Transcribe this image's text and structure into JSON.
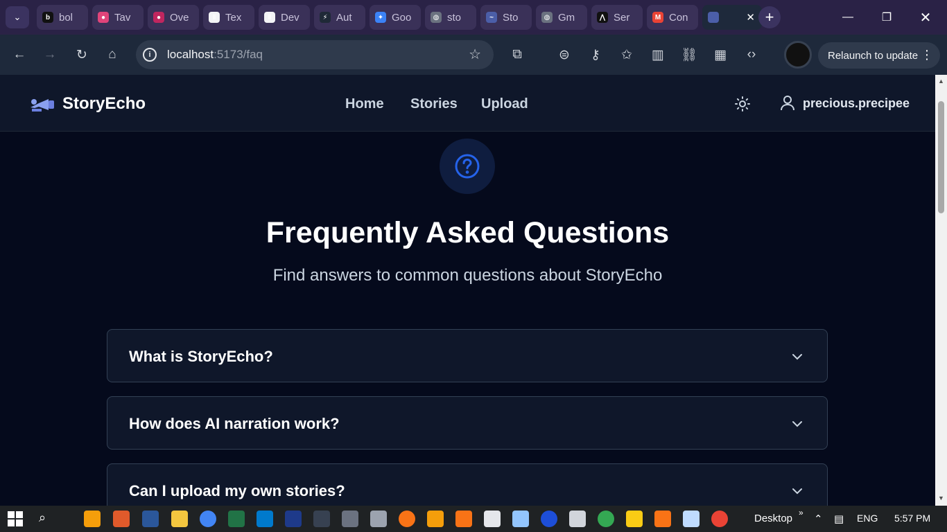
{
  "browser": {
    "tabs": [
      {
        "label": "bol",
        "fav_color": "#111111",
        "fav_glyph": "b"
      },
      {
        "label": "Tav",
        "fav_color": "#e0447a",
        "fav_glyph": "●"
      },
      {
        "label": "Ove",
        "fav_color": "#c0265f",
        "fav_glyph": "●"
      },
      {
        "label": "Tex",
        "fav_color": "#f3f4f6",
        "fav_glyph": "‖"
      },
      {
        "label": "Dev",
        "fav_color": "#f3f4f6",
        "fav_glyph": "‖"
      },
      {
        "label": "Aut",
        "fav_color": "#1f2937",
        "fav_glyph": "⚡"
      },
      {
        "label": "Goo",
        "fav_color": "#3b82f6",
        "fav_glyph": "✦"
      },
      {
        "label": "sto",
        "fav_color": "#6b7280",
        "fav_glyph": "◍"
      },
      {
        "label": "Sto",
        "fav_color": "#4b5ea8",
        "fav_glyph": "~"
      },
      {
        "label": "Gm",
        "fav_color": "#6b7280",
        "fav_glyph": "◍"
      },
      {
        "label": "Ser",
        "fav_color": "#111111",
        "fav_glyph": "⋀"
      },
      {
        "label": "Con",
        "fav_color": "#ea4335",
        "fav_glyph": "M"
      }
    ],
    "active_tab_close": "✕",
    "new_tab": "+",
    "url_host": "localhost",
    "url_path": ":5173/faq",
    "relaunch_label": "Relaunch to update"
  },
  "app": {
    "brand": "StoryEcho",
    "nav": [
      "Home",
      "Stories",
      "Upload"
    ],
    "username": "precious.precipee",
    "title": "Frequently Asked Questions",
    "subtitle": "Find answers to common questions about StoryEcho",
    "faqs": [
      "What is StoryEcho?",
      "How does AI narration work?",
      "Can I upload my own stories?"
    ],
    "accent": "#2563eb"
  },
  "taskbar": {
    "desktop_label": "Desktop",
    "lang": "ENG",
    "time": "5:57 PM"
  }
}
